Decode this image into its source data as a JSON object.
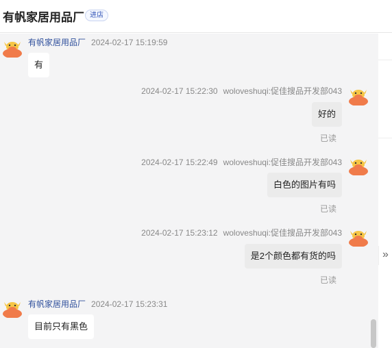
{
  "header": {
    "title": "有帆家居用品厂",
    "badge": "进店"
  },
  "messages": [
    {
      "side": "left",
      "sender": "有帆家居用品厂",
      "time": "2024-02-17 15:19:59",
      "text": "有"
    },
    {
      "side": "right",
      "sender": "woloveshuqi:促佳搜品开发部043",
      "time": "2024-02-17 15:22:30",
      "text": "好的",
      "status": "已读"
    },
    {
      "side": "right",
      "sender": "woloveshuqi:促佳搜品开发部043",
      "time": "2024-02-17 15:22:49",
      "text": "白色的图片有吗",
      "status": "已读"
    },
    {
      "side": "right",
      "sender": "woloveshuqi:促佳搜品开发部043",
      "time": "2024-02-17 15:23:12",
      "text": "是2个颜色都有货的吗",
      "status": "已读"
    },
    {
      "side": "left",
      "sender": "有帆家居用品厂",
      "time": "2024-02-17 15:23:31",
      "text": "目前只有黑色"
    }
  ],
  "icons": {
    "avatar": "cow-avatar-icon",
    "collapse": "double-chevron-right-icon"
  },
  "colors": {
    "avatar_body": "#f07b4a",
    "avatar_face": "#f6c646",
    "sender_name": "#2f4f9c"
  }
}
